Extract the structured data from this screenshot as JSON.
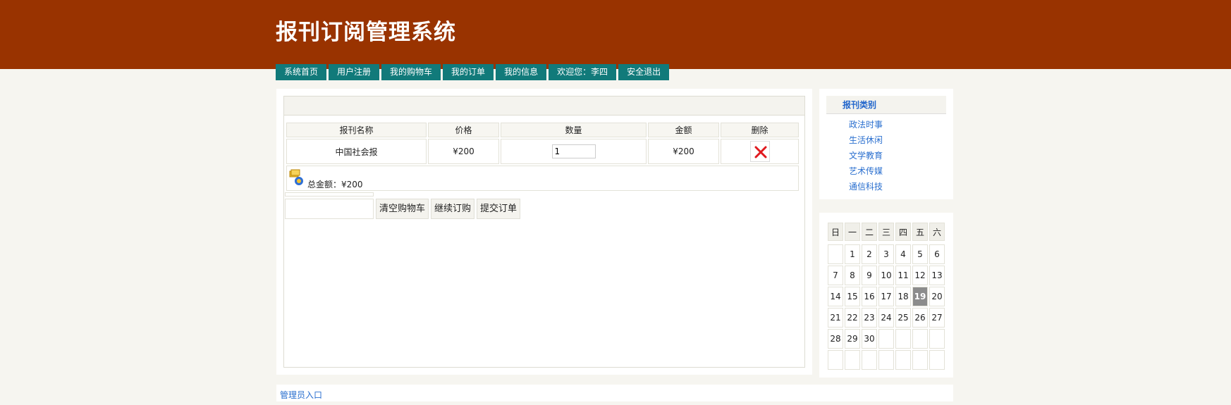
{
  "header": {
    "title": "报刊订阅管理系统"
  },
  "nav": [
    {
      "label": "系统首页"
    },
    {
      "label": "用户注册"
    },
    {
      "label": "我的购物车"
    },
    {
      "label": "我的订单"
    },
    {
      "label": "我的信息"
    },
    {
      "label": "欢迎您：李四"
    },
    {
      "label": "安全退出"
    }
  ],
  "cart": {
    "columns": [
      "报刊名称",
      "价格",
      "数量",
      "金额",
      "删除"
    ],
    "rows": [
      {
        "name": "中国社会报",
        "price": "¥200",
        "quantity": "1",
        "amount": "¥200",
        "delete_icon": "delete-x-icon"
      }
    ],
    "total_label": "总金额：¥200",
    "buttons": {
      "clear": "清空购物车",
      "continue": "继续订购",
      "submit": "提交订单"
    }
  },
  "sidebar": {
    "title": "报刊类别",
    "categories": [
      "政法时事",
      "生活休闲",
      "文学教育",
      "艺术传媒",
      "通信科技"
    ]
  },
  "calendar": {
    "weekdays": [
      "日",
      "一",
      "二",
      "三",
      "四",
      "五",
      "六"
    ],
    "weeks": [
      [
        "",
        "1",
        "2",
        "3",
        "4",
        "5",
        "6"
      ],
      [
        "7",
        "8",
        "9",
        "10",
        "11",
        "12",
        "13"
      ],
      [
        "14",
        "15",
        "16",
        "17",
        "18",
        "19",
        "20"
      ],
      [
        "21",
        "22",
        "23",
        "24",
        "25",
        "26",
        "27"
      ],
      [
        "28",
        "29",
        "30",
        "",
        "",
        "",
        ""
      ],
      [
        "",
        "",
        "",
        "",
        "",
        "",
        ""
      ]
    ],
    "today": "19"
  },
  "footer": {
    "admin_link": "管理员入口"
  },
  "colors": {
    "header_bg": "#993300",
    "nav_bg": "#117a7a",
    "link": "#2a6fcf"
  }
}
